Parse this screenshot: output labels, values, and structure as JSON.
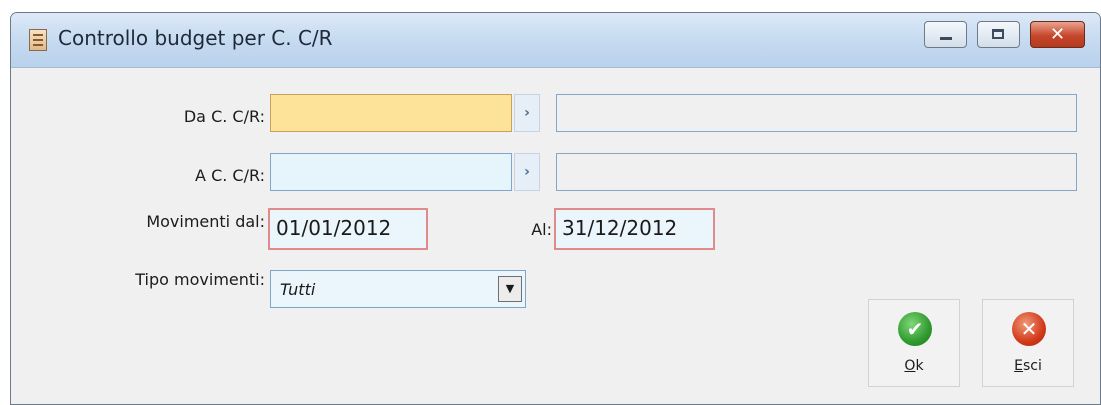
{
  "window": {
    "title": "Controllo budget per C. C/R",
    "app_icon": "document-icon",
    "controls": [
      "minimize-icon",
      "maximize-icon",
      "close-icon"
    ]
  },
  "form": {
    "da_label": "Da C. C/R:",
    "da_value": "",
    "da_description": "",
    "a_label": "A C. C/R:",
    "a_value": "",
    "a_description": "",
    "zoom_glyph": "›",
    "movimenti_dal_label": "Movimenti dal:",
    "movimenti_dal_value": "01/01/2012",
    "al_label": "Al:",
    "al_value": "31/12/2012",
    "tipo_movimenti_label": "Tipo movimenti:",
    "tipo_movimenti_value": "Tutti"
  },
  "buttons": {
    "ok": {
      "icon": "check-icon",
      "mnemonic": "O",
      "rest": "k"
    },
    "esci": {
      "icon": "x-circle-icon",
      "mnemonic": "E",
      "rest": "sci"
    }
  },
  "colors": {
    "required_field": "#fde39a",
    "input_field": "#e6f4fc",
    "date_border": "#e08a8a"
  }
}
